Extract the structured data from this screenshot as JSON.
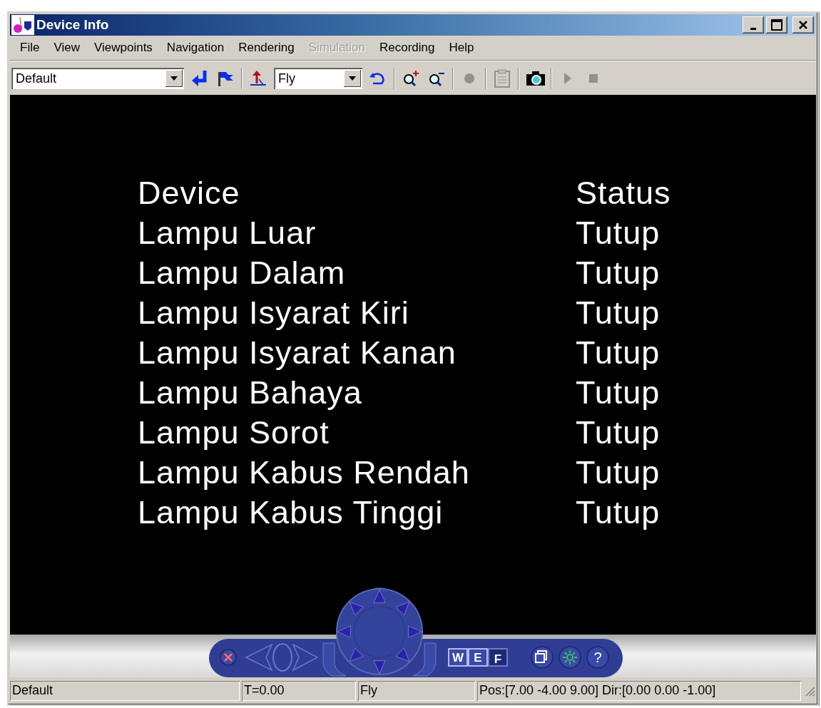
{
  "window": {
    "title": "Device Info"
  },
  "menu": [
    {
      "label": "File",
      "disabled": false
    },
    {
      "label": "View",
      "disabled": false
    },
    {
      "label": "Viewpoints",
      "disabled": false
    },
    {
      "label": "Navigation",
      "disabled": false
    },
    {
      "label": "Rendering",
      "disabled": false
    },
    {
      "label": "Simulation",
      "disabled": true
    },
    {
      "label": "Recording",
      "disabled": false
    },
    {
      "label": "Help",
      "disabled": false
    }
  ],
  "toolbar": {
    "viewpoint": "Default",
    "mode": "Fly"
  },
  "viewport": {
    "columns": [
      "Device",
      "Status"
    ],
    "rows": [
      {
        "device": "Lampu Luar",
        "status": "Tutup"
      },
      {
        "device": "Lampu Dalam",
        "status": "Tutup"
      },
      {
        "device": "Lampu Isyarat Kiri",
        "status": "Tutup"
      },
      {
        "device": "Lampu Isyarat Kanan",
        "status": "Tutup"
      },
      {
        "device": "Lampu Bahaya",
        "status": "Tutup"
      },
      {
        "device": "Lampu Sorot",
        "status": "Tutup"
      },
      {
        "device": "Lampu Kabus Rendah",
        "status": "Tutup"
      },
      {
        "device": "Lampu Kabus Tinggi",
        "status": "Tutup"
      }
    ]
  },
  "navigator": {
    "view_buttons": [
      {
        "label": "W",
        "selected": false
      },
      {
        "label": "E",
        "selected": false
      },
      {
        "label": "F",
        "selected": true
      }
    ],
    "help": "?"
  },
  "status_bar": [
    "Default",
    "T=0.00",
    "Fly",
    "Pos:[7.00 -4.00 9.00] Dir:[0.00 0.00 -1.00]"
  ]
}
